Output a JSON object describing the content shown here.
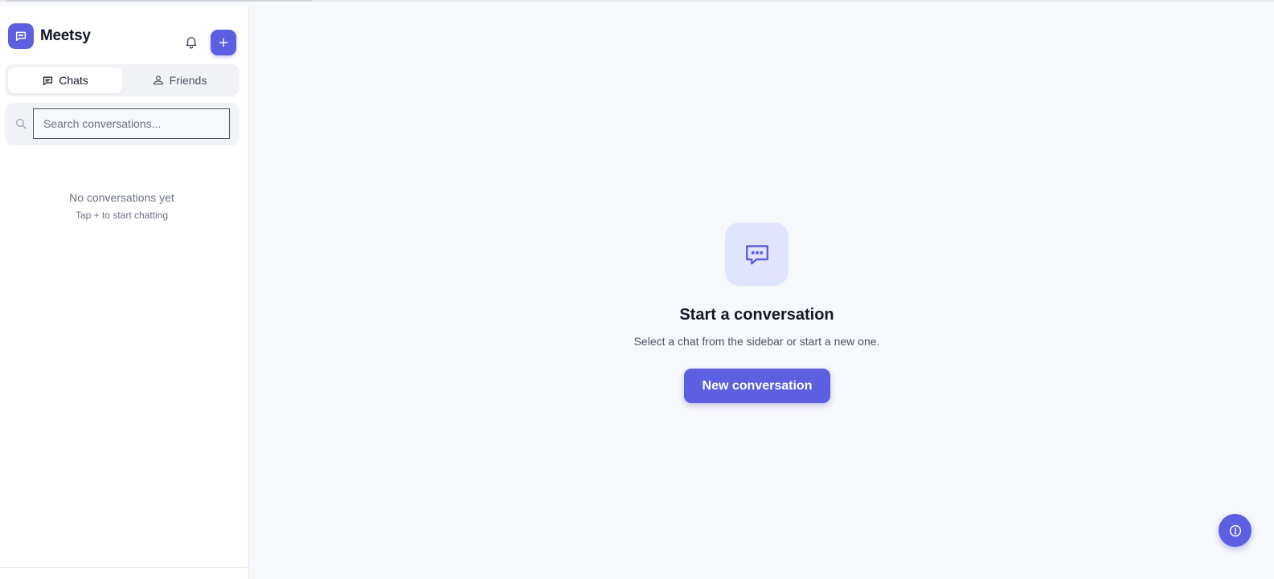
{
  "app": {
    "name": "Meetsy",
    "accent_color": "#5b5fe0"
  },
  "header": {
    "logo_icon": "chat-bubble-icon",
    "notifications_icon": "bell-icon",
    "new_chat_icon": "plus-icon"
  },
  "tabs": [
    {
      "label": "Chats",
      "icon": "chat-bubble-icon",
      "active": true
    },
    {
      "label": "Friends",
      "icon": "friends-icon",
      "active": false
    }
  ],
  "search": {
    "placeholder": "Search conversations...",
    "value": "",
    "icon": "search-icon"
  },
  "sidebar_empty": {
    "title": "No conversations yet",
    "subtitle": "Tap + to start chatting"
  },
  "main": {
    "icon": "chat-dots-icon",
    "title": "Start a conversation",
    "subtitle": "Select a chat from the sidebar or start a new one.",
    "button_label": "New conversation"
  },
  "fab": {
    "icon": "info-icon"
  }
}
